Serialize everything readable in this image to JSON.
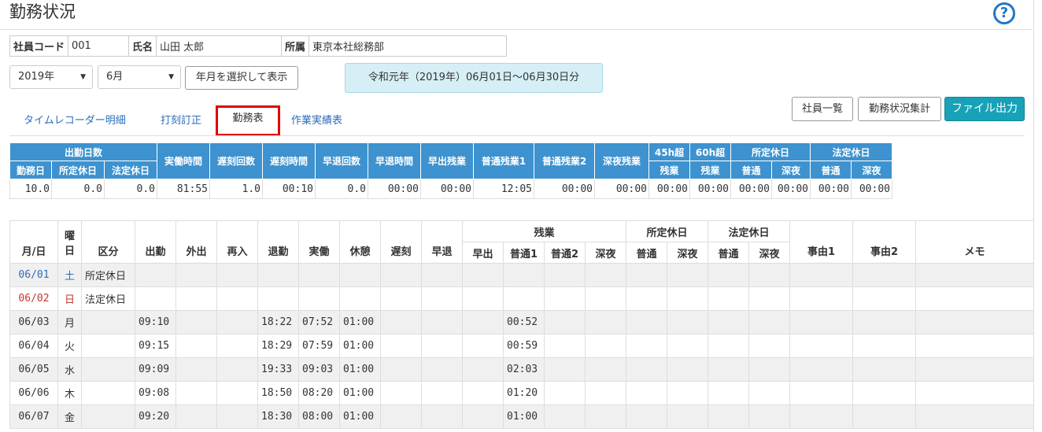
{
  "page": {
    "title": "勤務状況",
    "help_icon": "question-circle-icon",
    "accent": "#2276c5"
  },
  "employee": {
    "code_label": "社員コード",
    "code": "001",
    "name_label": "氏名",
    "name": "山田 太郎",
    "dept_label": "所属",
    "dept": "東京本社総務部"
  },
  "filters": {
    "year": "2019年",
    "month": "6月",
    "show_button": "年月を選択して表示",
    "period": "令和元年（2019年）06月01日～06月30日分"
  },
  "tabs": [
    "タイムレコーダー明細",
    "打刻訂正",
    "勤務表",
    "作業実績表"
  ],
  "actions": {
    "employee_list": "社員一覧",
    "summary": "勤務状況集計",
    "export": "ファイル出力",
    "export_color": "#17a2b8"
  },
  "summary": {
    "group_attend": "出勤日数",
    "headers": [
      "勤務日",
      "所定休日",
      "法定休日",
      "実働時間",
      "遅刻回数",
      "遅刻時間",
      "早退回数",
      "早退時間",
      "早出残業",
      "普通残業1",
      "普通残業2",
      "深夜残業"
    ],
    "h45a": "45h超",
    "h45b": "残業",
    "h60a": "60h超",
    "h60b": "残業",
    "group_sched": "所定休日",
    "group_legal": "法定休日",
    "normal": "普通",
    "night": "深夜",
    "values": [
      "10.0",
      "0.0",
      "0.0",
      "81:55",
      "1.0",
      "00:10",
      "0.0",
      "00:00",
      "00:00",
      "12:05",
      "00:00",
      "00:00",
      "00:00",
      "00:00",
      "00:00",
      "00:00",
      "00:00",
      "00:00"
    ],
    "header_color": "#3d92cf"
  },
  "daily": {
    "h_date": "月/日",
    "h_dow1": "曜",
    "h_dow2": "日",
    "h_type": "区分",
    "h_in": "出勤",
    "h_out": "外出",
    "h_re": "再入",
    "h_leave": "退勤",
    "h_work": "実働",
    "h_break": "休憩",
    "h_late": "遅刻",
    "h_early": "早退",
    "g_ot": "残業",
    "h_ot_early": "早出",
    "h_ot1": "普通1",
    "h_ot2": "普通2",
    "h_ot_night": "深夜",
    "g_sched": "所定休日",
    "g_legal": "法定休日",
    "normal": "普通",
    "night": "深夜",
    "h_r1": "事由1",
    "h_r2": "事由2",
    "h_memo": "メモ",
    "rows": [
      {
        "date": "06/01",
        "dow": "土",
        "cls": "sat",
        "type": "所定休日",
        "in": "",
        "leave": "",
        "work": "",
        "brk": "",
        "ot1": ""
      },
      {
        "date": "06/02",
        "dow": "日",
        "cls": "sun",
        "type": "法定休日",
        "in": "",
        "leave": "",
        "work": "",
        "brk": "",
        "ot1": ""
      },
      {
        "date": "06/03",
        "dow": "月",
        "cls": "",
        "type": "",
        "in": "09:10",
        "leave": "18:22",
        "work": "07:52",
        "brk": "01:00",
        "ot1": "00:52"
      },
      {
        "date": "06/04",
        "dow": "火",
        "cls": "",
        "type": "",
        "in": "09:15",
        "leave": "18:29",
        "work": "07:59",
        "brk": "01:00",
        "ot1": "00:59"
      },
      {
        "date": "06/05",
        "dow": "水",
        "cls": "",
        "type": "",
        "in": "09:09",
        "leave": "19:33",
        "work": "09:03",
        "brk": "01:00",
        "ot1": "02:03"
      },
      {
        "date": "06/06",
        "dow": "木",
        "cls": "",
        "type": "",
        "in": "09:08",
        "leave": "18:50",
        "work": "08:20",
        "brk": "01:00",
        "ot1": "01:20"
      },
      {
        "date": "06/07",
        "dow": "金",
        "cls": "",
        "type": "",
        "in": "09:20",
        "leave": "18:30",
        "work": "08:00",
        "brk": "01:00",
        "ot1": "01:00"
      }
    ]
  }
}
